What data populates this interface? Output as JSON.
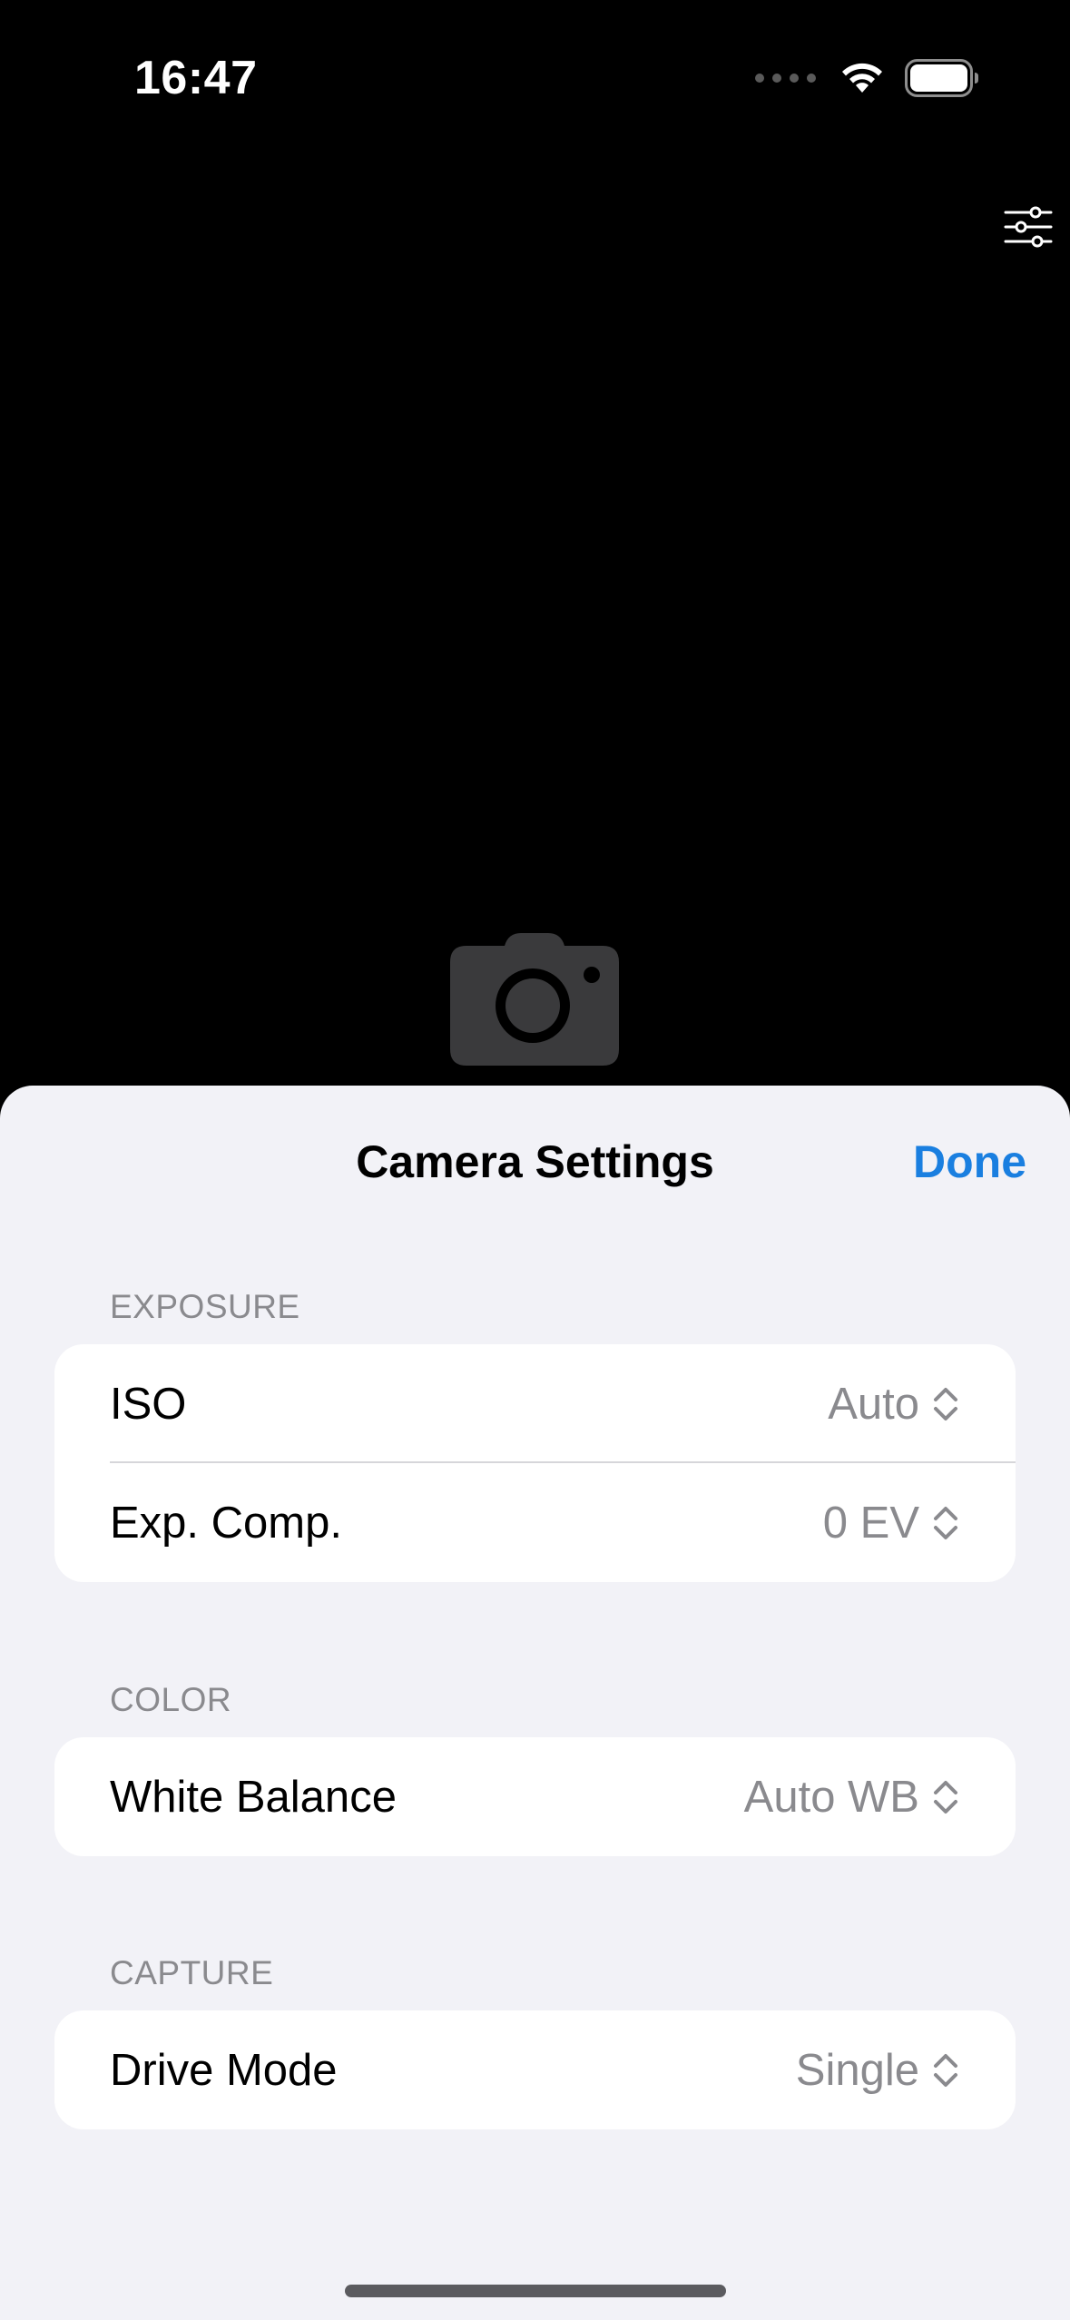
{
  "status_bar": {
    "time": "16:47"
  },
  "icons": {
    "wifi": "wifi-icon",
    "battery": "battery-icon",
    "filter": "sliders-icon",
    "camera": "camera-icon",
    "chevron": "chevron-up-down-icon"
  },
  "sheet": {
    "title": "Camera Settings",
    "done_label": "Done",
    "sections": [
      {
        "header": "EXPOSURE",
        "rows": [
          {
            "label": "ISO",
            "value": "Auto"
          },
          {
            "label": "Exp. Comp.",
            "value": "0 EV"
          }
        ]
      },
      {
        "header": "COLOR",
        "rows": [
          {
            "label": "White Balance",
            "value": "Auto WB"
          }
        ]
      },
      {
        "header": "CAPTURE",
        "rows": [
          {
            "label": "Drive Mode",
            "value": "Single"
          }
        ]
      }
    ]
  },
  "colors": {
    "accent": "#1a7fe0",
    "sheet_background": "#f2f2f7",
    "secondary_text": "#8a8a8e"
  }
}
